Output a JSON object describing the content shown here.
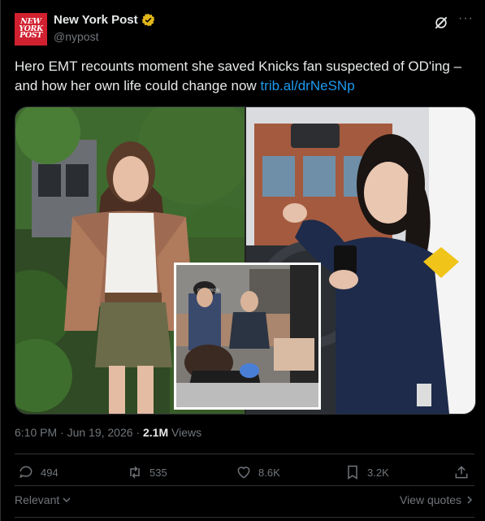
{
  "account": {
    "display_name": "New York Post",
    "handle": "@nypost",
    "avatar_text": "NEW\nYORK\nPOST"
  },
  "tweet": {
    "text": "Hero EMT recounts moment she saved Knicks fan suspected of OD'ing – and how her own life could change now ",
    "link": "trib.al/drNeSNp",
    "time": "6:10 PM · Jun 19, 2026 · ",
    "views_count": "2.1M",
    "views_label": " Views"
  },
  "actions": {
    "replies": "494",
    "reposts": "535",
    "likes": "8.6K",
    "bookmarks": "3.2K"
  },
  "footer": {
    "sort_label": "Relevant",
    "quotes_label": "View quotes"
  },
  "media": {
    "inset_cap_text": "CHAMPION"
  },
  "colors": {
    "link": "#1d9bf0",
    "brand_red": "#d1202f",
    "verified_gold": "#e2b719"
  },
  "icons": [
    "verified-badge-icon",
    "grok-icon",
    "more-icon",
    "reply-icon",
    "repost-icon",
    "like-icon",
    "bookmark-icon",
    "share-icon",
    "chevron-down-icon",
    "chevron-right-icon"
  ]
}
